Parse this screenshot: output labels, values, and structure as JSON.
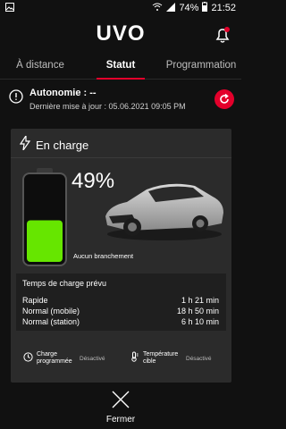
{
  "status_bar": {
    "battery_percent": "74%",
    "time": "21:52"
  },
  "header": {
    "logo": "UVO"
  },
  "tabs": [
    {
      "label": "À distance",
      "active": false
    },
    {
      "label": "Statut",
      "active": true
    },
    {
      "label": "Programmation",
      "active": false
    }
  ],
  "autonomy": {
    "label": "Autonomie : --",
    "last_update": "Dernière mise à jour : 05.06.2021 09:05 PM"
  },
  "charge_card": {
    "title": "En charge",
    "percent": "49%",
    "battery_level": 0.49,
    "plug_status": "Aucun branchement",
    "charge_time": {
      "title": "Temps de charge prévu",
      "rows": [
        {
          "label": "Rapide",
          "value": "1 h 21 min"
        },
        {
          "label": "Normal (mobile)",
          "value": "18 h 50 min"
        },
        {
          "label": "Normal (station)",
          "value": "6 h 10 min"
        }
      ]
    },
    "settings": [
      {
        "name": "Charge programmée",
        "value": "Désactivé",
        "icon": "clock-icon"
      },
      {
        "name": "Température cible",
        "value": "Désactivé",
        "icon": "thermometer-icon"
      }
    ]
  },
  "close": {
    "label": "Fermer"
  },
  "colors": {
    "accent": "#e3002b",
    "battery_green": "#66e600",
    "background": "#111111",
    "card": "#2b2b2b"
  }
}
